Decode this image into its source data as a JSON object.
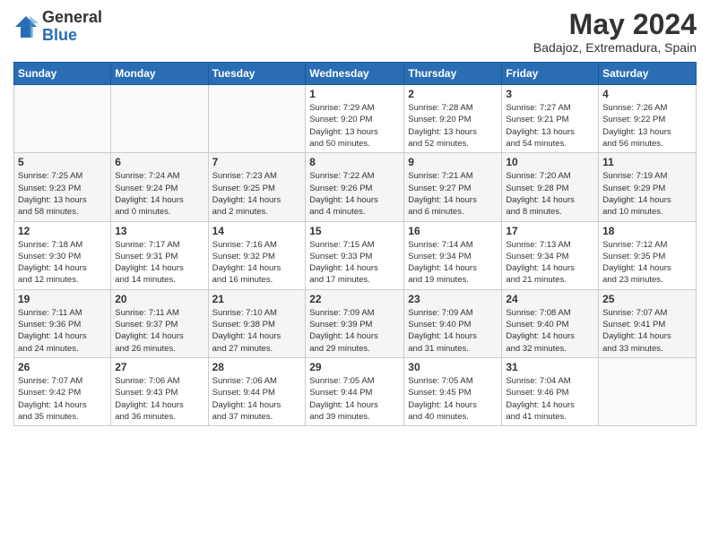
{
  "header": {
    "logo_general": "General",
    "logo_blue": "Blue",
    "month_title": "May 2024",
    "subtitle": "Badajoz, Extremadura, Spain"
  },
  "days_of_week": [
    "Sunday",
    "Monday",
    "Tuesday",
    "Wednesday",
    "Thursday",
    "Friday",
    "Saturday"
  ],
  "weeks": [
    [
      {
        "day": "",
        "info": ""
      },
      {
        "day": "",
        "info": ""
      },
      {
        "day": "",
        "info": ""
      },
      {
        "day": "1",
        "info": "Sunrise: 7:29 AM\nSunset: 9:20 PM\nDaylight: 13 hours\nand 50 minutes."
      },
      {
        "day": "2",
        "info": "Sunrise: 7:28 AM\nSunset: 9:20 PM\nDaylight: 13 hours\nand 52 minutes."
      },
      {
        "day": "3",
        "info": "Sunrise: 7:27 AM\nSunset: 9:21 PM\nDaylight: 13 hours\nand 54 minutes."
      },
      {
        "day": "4",
        "info": "Sunrise: 7:26 AM\nSunset: 9:22 PM\nDaylight: 13 hours\nand 56 minutes."
      }
    ],
    [
      {
        "day": "5",
        "info": "Sunrise: 7:25 AM\nSunset: 9:23 PM\nDaylight: 13 hours\nand 58 minutes."
      },
      {
        "day": "6",
        "info": "Sunrise: 7:24 AM\nSunset: 9:24 PM\nDaylight: 14 hours\nand 0 minutes."
      },
      {
        "day": "7",
        "info": "Sunrise: 7:23 AM\nSunset: 9:25 PM\nDaylight: 14 hours\nand 2 minutes."
      },
      {
        "day": "8",
        "info": "Sunrise: 7:22 AM\nSunset: 9:26 PM\nDaylight: 14 hours\nand 4 minutes."
      },
      {
        "day": "9",
        "info": "Sunrise: 7:21 AM\nSunset: 9:27 PM\nDaylight: 14 hours\nand 6 minutes."
      },
      {
        "day": "10",
        "info": "Sunrise: 7:20 AM\nSunset: 9:28 PM\nDaylight: 14 hours\nand 8 minutes."
      },
      {
        "day": "11",
        "info": "Sunrise: 7:19 AM\nSunset: 9:29 PM\nDaylight: 14 hours\nand 10 minutes."
      }
    ],
    [
      {
        "day": "12",
        "info": "Sunrise: 7:18 AM\nSunset: 9:30 PM\nDaylight: 14 hours\nand 12 minutes."
      },
      {
        "day": "13",
        "info": "Sunrise: 7:17 AM\nSunset: 9:31 PM\nDaylight: 14 hours\nand 14 minutes."
      },
      {
        "day": "14",
        "info": "Sunrise: 7:16 AM\nSunset: 9:32 PM\nDaylight: 14 hours\nand 16 minutes."
      },
      {
        "day": "15",
        "info": "Sunrise: 7:15 AM\nSunset: 9:33 PM\nDaylight: 14 hours\nand 17 minutes."
      },
      {
        "day": "16",
        "info": "Sunrise: 7:14 AM\nSunset: 9:34 PM\nDaylight: 14 hours\nand 19 minutes."
      },
      {
        "day": "17",
        "info": "Sunrise: 7:13 AM\nSunset: 9:34 PM\nDaylight: 14 hours\nand 21 minutes."
      },
      {
        "day": "18",
        "info": "Sunrise: 7:12 AM\nSunset: 9:35 PM\nDaylight: 14 hours\nand 23 minutes."
      }
    ],
    [
      {
        "day": "19",
        "info": "Sunrise: 7:11 AM\nSunset: 9:36 PM\nDaylight: 14 hours\nand 24 minutes."
      },
      {
        "day": "20",
        "info": "Sunrise: 7:11 AM\nSunset: 9:37 PM\nDaylight: 14 hours\nand 26 minutes."
      },
      {
        "day": "21",
        "info": "Sunrise: 7:10 AM\nSunset: 9:38 PM\nDaylight: 14 hours\nand 27 minutes."
      },
      {
        "day": "22",
        "info": "Sunrise: 7:09 AM\nSunset: 9:39 PM\nDaylight: 14 hours\nand 29 minutes."
      },
      {
        "day": "23",
        "info": "Sunrise: 7:09 AM\nSunset: 9:40 PM\nDaylight: 14 hours\nand 31 minutes."
      },
      {
        "day": "24",
        "info": "Sunrise: 7:08 AM\nSunset: 9:40 PM\nDaylight: 14 hours\nand 32 minutes."
      },
      {
        "day": "25",
        "info": "Sunrise: 7:07 AM\nSunset: 9:41 PM\nDaylight: 14 hours\nand 33 minutes."
      }
    ],
    [
      {
        "day": "26",
        "info": "Sunrise: 7:07 AM\nSunset: 9:42 PM\nDaylight: 14 hours\nand 35 minutes."
      },
      {
        "day": "27",
        "info": "Sunrise: 7:06 AM\nSunset: 9:43 PM\nDaylight: 14 hours\nand 36 minutes."
      },
      {
        "day": "28",
        "info": "Sunrise: 7:06 AM\nSunset: 9:44 PM\nDaylight: 14 hours\nand 37 minutes."
      },
      {
        "day": "29",
        "info": "Sunrise: 7:05 AM\nSunset: 9:44 PM\nDaylight: 14 hours\nand 39 minutes."
      },
      {
        "day": "30",
        "info": "Sunrise: 7:05 AM\nSunset: 9:45 PM\nDaylight: 14 hours\nand 40 minutes."
      },
      {
        "day": "31",
        "info": "Sunrise: 7:04 AM\nSunset: 9:46 PM\nDaylight: 14 hours\nand 41 minutes."
      },
      {
        "day": "",
        "info": ""
      }
    ]
  ]
}
